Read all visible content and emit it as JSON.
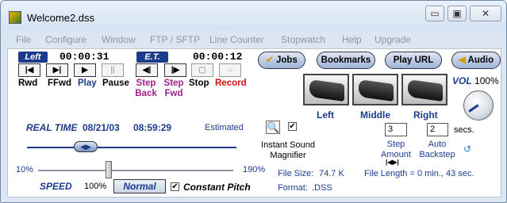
{
  "window": {
    "title": "Welcome2.dss"
  },
  "menu": [
    "File",
    "Configure",
    "Window",
    "FTP / SFTP",
    "Line Counter",
    "Stopwatch",
    "Help",
    "Upgrade"
  ],
  "times": {
    "left_label": "Left",
    "left_value": "00:00:31",
    "et_label": "E.T.",
    "et_value": "00:00:12"
  },
  "transport": {
    "rwd": "Rwd",
    "ffwd": "FFwd",
    "play": "Play",
    "pause": "Pause",
    "step_back": "Step Back",
    "step_fwd": "Step Fwd",
    "stop": "Stop",
    "record": "Record"
  },
  "buttons": {
    "jobs": "Jobs",
    "bookmarks": "Bookmarks",
    "play_url": "Play URL",
    "audio": "Audio"
  },
  "pedals": {
    "left": "Left",
    "middle": "Middle",
    "right": "Right"
  },
  "volume": {
    "label": "VOL",
    "value": "100%"
  },
  "realtime": {
    "label": "REAL TIME",
    "date": "08/21/03",
    "time": "08:59:29",
    "estimated": "Estimated"
  },
  "speed": {
    "min": "10%",
    "max": "190%",
    "label": "SPEED",
    "value": "100%",
    "normal": "Normal",
    "constant_pitch": "Constant Pitch",
    "position": 0.36
  },
  "magnifier": {
    "label": "Instant Sound Magnifier",
    "checked": true
  },
  "file": {
    "size_label": "File Size:",
    "size": "74.7 K",
    "format_label": "Format:",
    "format": ".DSS",
    "length": "File Length = 0 min., 43 sec."
  },
  "step": {
    "amount_value": "3",
    "amount_label": "Step Amount",
    "backstep_value": "2",
    "backstep_label": "Auto Backstep",
    "secs": "secs."
  }
}
